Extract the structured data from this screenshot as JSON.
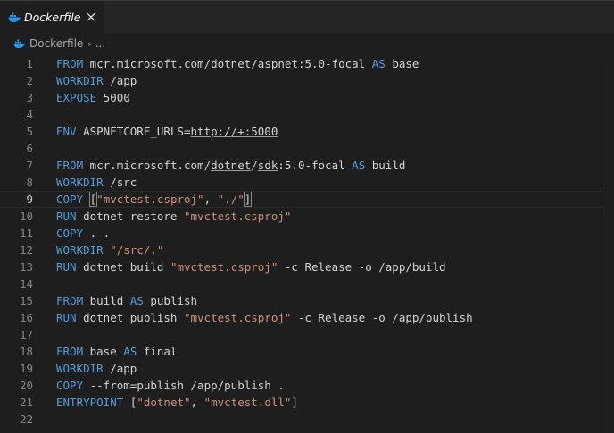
{
  "tab": {
    "title": "Dockerfile",
    "close_icon": "×",
    "icon": "docker-whale-icon"
  },
  "breadcrumb": {
    "file": "Dockerfile",
    "separator": "›",
    "more": "..."
  },
  "editor": {
    "current_line": 9,
    "lines": [
      {
        "n": "1",
        "tokens": [
          {
            "t": "kw",
            "v": "FROM"
          },
          {
            "t": "pl",
            "v": " mcr.microsoft.com/"
          },
          {
            "t": "u",
            "v": "dotnet"
          },
          {
            "t": "pl",
            "v": "/"
          },
          {
            "t": "u",
            "v": "aspnet"
          },
          {
            "t": "pl",
            "v": ":5.0-focal "
          },
          {
            "t": "kw",
            "v": "AS"
          },
          {
            "t": "pl",
            "v": " base"
          }
        ]
      },
      {
        "n": "2",
        "tokens": [
          {
            "t": "kw",
            "v": "WORKDIR"
          },
          {
            "t": "pl",
            "v": " /app"
          }
        ]
      },
      {
        "n": "3",
        "tokens": [
          {
            "t": "kw",
            "v": "EXPOSE"
          },
          {
            "t": "pl",
            "v": " 5000"
          }
        ]
      },
      {
        "n": "4",
        "tokens": []
      },
      {
        "n": "5",
        "tokens": [
          {
            "t": "kw",
            "v": "ENV"
          },
          {
            "t": "pl",
            "v": " ASPNETCORE_URLS="
          },
          {
            "t": "u",
            "v": "http://+:5000"
          }
        ]
      },
      {
        "n": "6",
        "tokens": []
      },
      {
        "n": "7",
        "tokens": [
          {
            "t": "kw",
            "v": "FROM"
          },
          {
            "t": "pl",
            "v": " mcr.microsoft.com/"
          },
          {
            "t": "u",
            "v": "dotnet"
          },
          {
            "t": "pl",
            "v": "/"
          },
          {
            "t": "u",
            "v": "sdk"
          },
          {
            "t": "pl",
            "v": ":5.0-focal "
          },
          {
            "t": "kw",
            "v": "AS"
          },
          {
            "t": "pl",
            "v": " build"
          }
        ]
      },
      {
        "n": "8",
        "tokens": [
          {
            "t": "kw",
            "v": "WORKDIR"
          },
          {
            "t": "pl",
            "v": " /src"
          }
        ]
      },
      {
        "n": "9",
        "tokens": [
          {
            "t": "kw",
            "v": "COPY"
          },
          {
            "t": "pl",
            "v": " "
          },
          {
            "t": "br",
            "v": "["
          },
          {
            "t": "st",
            "v": "\"mvctest.csproj\""
          },
          {
            "t": "pl",
            "v": ", "
          },
          {
            "t": "st",
            "v": "\"./\""
          },
          {
            "t": "br",
            "v": "]"
          },
          {
            "t": "cursor",
            "v": ""
          }
        ]
      },
      {
        "n": "10",
        "tokens": [
          {
            "t": "kw",
            "v": "RUN"
          },
          {
            "t": "pl",
            "v": " dotnet restore "
          },
          {
            "t": "st",
            "v": "\"mvctest.csproj\""
          }
        ]
      },
      {
        "n": "11",
        "tokens": [
          {
            "t": "kw",
            "v": "COPY"
          },
          {
            "t": "pl",
            "v": " . ."
          }
        ]
      },
      {
        "n": "12",
        "tokens": [
          {
            "t": "kw",
            "v": "WORKDIR"
          },
          {
            "t": "pl",
            "v": " "
          },
          {
            "t": "st",
            "v": "\"/src/.\""
          }
        ]
      },
      {
        "n": "13",
        "tokens": [
          {
            "t": "kw",
            "v": "RUN"
          },
          {
            "t": "pl",
            "v": " dotnet build "
          },
          {
            "t": "st",
            "v": "\"mvctest.csproj\""
          },
          {
            "t": "pl",
            "v": " -c Release -o /app/build"
          }
        ]
      },
      {
        "n": "14",
        "tokens": []
      },
      {
        "n": "15",
        "tokens": [
          {
            "t": "kw",
            "v": "FROM"
          },
          {
            "t": "pl",
            "v": " build "
          },
          {
            "t": "kw",
            "v": "AS"
          },
          {
            "t": "pl",
            "v": " publish"
          }
        ]
      },
      {
        "n": "16",
        "tokens": [
          {
            "t": "kw",
            "v": "RUN"
          },
          {
            "t": "pl",
            "v": " dotnet publish "
          },
          {
            "t": "st",
            "v": "\"mvctest.csproj\""
          },
          {
            "t": "pl",
            "v": " -c Release -o /app/publish"
          }
        ]
      },
      {
        "n": "17",
        "tokens": []
      },
      {
        "n": "18",
        "tokens": [
          {
            "t": "kw",
            "v": "FROM"
          },
          {
            "t": "pl",
            "v": " base "
          },
          {
            "t": "kw",
            "v": "AS"
          },
          {
            "t": "pl",
            "v": " final"
          }
        ]
      },
      {
        "n": "19",
        "tokens": [
          {
            "t": "kw",
            "v": "WORKDIR"
          },
          {
            "t": "pl",
            "v": " /app"
          }
        ]
      },
      {
        "n": "20",
        "tokens": [
          {
            "t": "kw",
            "v": "COPY"
          },
          {
            "t": "pl",
            "v": " --from=publish /app/publish ."
          }
        ]
      },
      {
        "n": "21",
        "tokens": [
          {
            "t": "kw",
            "v": "ENTRYPOINT"
          },
          {
            "t": "pl",
            "v": " ["
          },
          {
            "t": "st",
            "v": "\"dotnet\""
          },
          {
            "t": "pl",
            "v": ", "
          },
          {
            "t": "st",
            "v": "\"mvctest.dll\""
          },
          {
            "t": "pl",
            "v": "]"
          }
        ]
      },
      {
        "n": "22",
        "tokens": []
      }
    ]
  },
  "colors": {
    "keyword": "#569cd6",
    "string": "#ce9178",
    "plain": "#d4d4d4",
    "background": "#1e1e1e"
  }
}
